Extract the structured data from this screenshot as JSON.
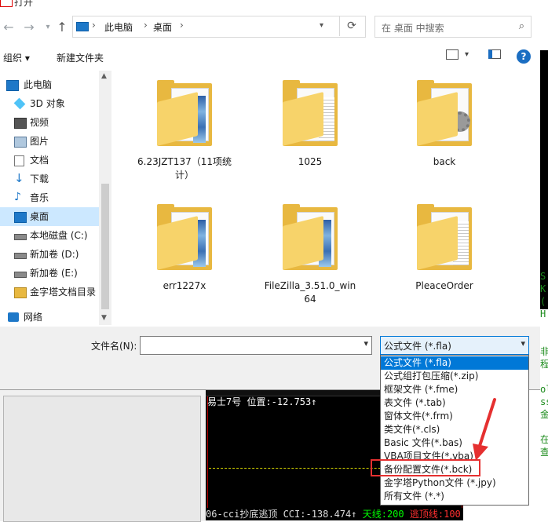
{
  "dialog": {
    "title": "打开"
  },
  "address": {
    "segments": [
      "此电脑",
      "桌面"
    ]
  },
  "search": {
    "placeholder": "在 桌面 中搜索"
  },
  "toolbar": {
    "organize": "组织 ▾",
    "new_folder": "新建文件夹"
  },
  "sidebar": {
    "items": [
      {
        "label": "此电脑",
        "icon": "computer-icon"
      },
      {
        "label": "3D 对象",
        "icon": "cube-icon"
      },
      {
        "label": "视频",
        "icon": "video-icon"
      },
      {
        "label": "图片",
        "icon": "picture-icon"
      },
      {
        "label": "文档",
        "icon": "document-icon"
      },
      {
        "label": "下载",
        "icon": "download-icon"
      },
      {
        "label": "音乐",
        "icon": "music-icon"
      },
      {
        "label": "桌面",
        "icon": "desktop-icon"
      },
      {
        "label": "本地磁盘 (C:)",
        "icon": "drive-icon"
      },
      {
        "label": "新加卷 (D:)",
        "icon": "drive-icon"
      },
      {
        "label": "新加卷 (E:)",
        "icon": "drive-icon"
      },
      {
        "label": "金字塔文档目录",
        "icon": "folder-icon"
      },
      {
        "label": "网络",
        "icon": "network-icon"
      }
    ]
  },
  "files": [
    {
      "name": "6.23JZT137（11项统计）",
      "kind": "folder-picture"
    },
    {
      "name": "1025",
      "kind": "folder-docs"
    },
    {
      "name": "back",
      "kind": "folder-gear"
    },
    {
      "name": "err1227x",
      "kind": "folder-picture"
    },
    {
      "name": "FileZilla_3.51.0_win64",
      "kind": "folder-picture"
    },
    {
      "name": "PleaceOrder",
      "kind": "folder-docs"
    }
  ],
  "bottom": {
    "filename_label": "文件名(N):",
    "filename_value": "",
    "filetype_selected": "公式文件 (*.fla)"
  },
  "filetype_options": [
    "公式文件 (*.fla)",
    "公式组打包压缩(*.zip)",
    "框架文件 (*.fme)",
    "表文件 (*.tab)",
    "窗体文件(*.frm)",
    "类文件(*.cls)",
    "Basic 文件(*.bas)",
    "VBA项目文件(*.vba)",
    "备份配置文件(*.bck)",
    "金字塔Python文件 (*.jpy)",
    "所有文件 (*.*)"
  ],
  "background": {
    "chart_header": "易士7号 位置:-12.753↑",
    "status_prefix": "06-cci抄底逃顶 CCI:-138.474↑",
    "status_green": "天线:200",
    "status_red": "逃顶线:100",
    "right_code": [
      "S",
      "K",
      "(",
      "H",
      "",
      "",
      "非",
      "程",
      "",
      "oldi",
      "sset",
      "金:c",
      "",
      "在查"
    ]
  },
  "colors": {
    "selection": "#0078d7",
    "highlight_box": "#e53030",
    "folder": "#e8b840"
  }
}
